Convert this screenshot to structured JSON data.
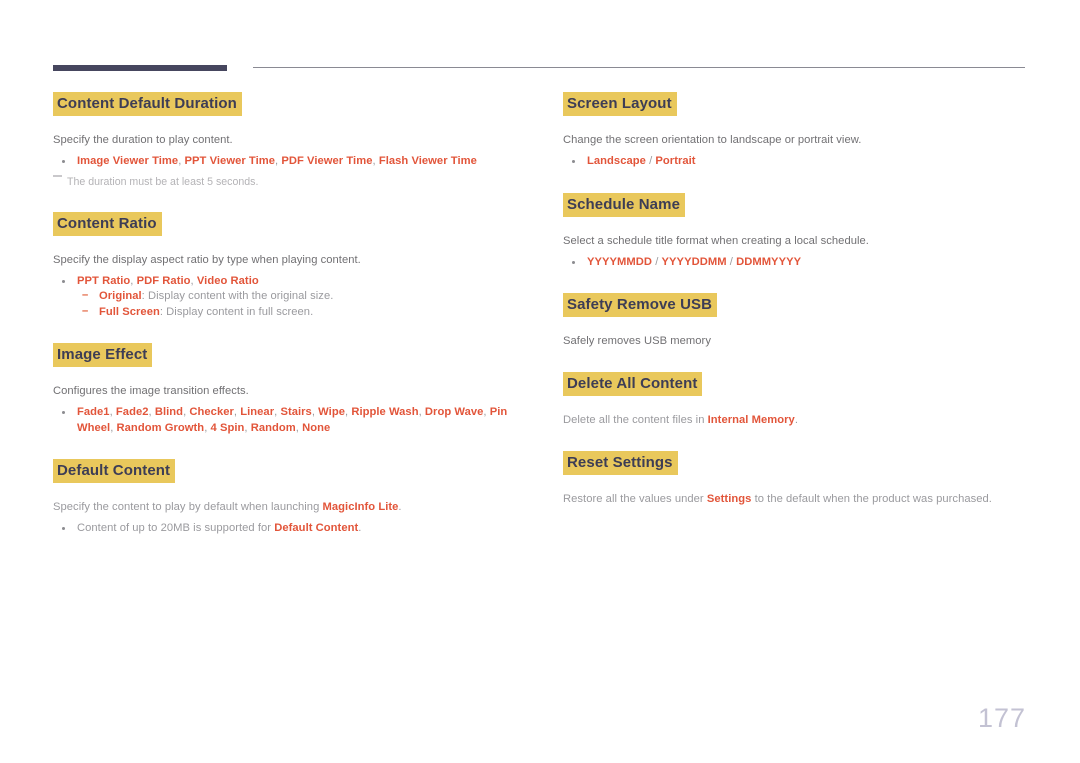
{
  "page": {
    "number": "177",
    "accent_highlight": "#e9c85c",
    "accent_keyword": "#e2553a",
    "heading_color": "#3d3d55",
    "body_color": "#717073",
    "rule_dark": "#46465e",
    "rule_thin": "#8a8a93"
  },
  "left_column": {
    "sections": [
      {
        "heading": "Content Default Duration",
        "desc": "Specify the duration to play content.",
        "bullets": [
          {
            "parts": [
              {
                "t": "Image Viewer Time",
                "k": true
              },
              {
                "t": ", ",
                "k": false
              },
              {
                "t": "PPT Viewer Time",
                "k": true
              },
              {
                "t": ", ",
                "k": false
              },
              {
                "t": "PDF Viewer Time",
                "k": true
              },
              {
                "t": ", ",
                "k": false
              },
              {
                "t": "Flash Viewer Time",
                "k": true
              }
            ]
          }
        ],
        "note": "The duration must be at least 5 seconds."
      },
      {
        "heading": "Content Ratio",
        "desc": "Specify the display aspect ratio by type when playing content.",
        "bullets": [
          {
            "parts": [
              {
                "t": "PPT Ratio",
                "k": true
              },
              {
                "t": ", ",
                "k": false
              },
              {
                "t": "PDF Ratio",
                "k": true
              },
              {
                "t": ", ",
                "k": false
              },
              {
                "t": "Video Ratio",
                "k": true
              }
            ],
            "sub": [
              {
                "parts": [
                  {
                    "t": "Original",
                    "k": true
                  },
                  {
                    "t": ": Display content with the original size.",
                    "k": false
                  }
                ]
              },
              {
                "parts": [
                  {
                    "t": "Full Screen",
                    "k": true
                  },
                  {
                    "t": ": Display content in full screen.",
                    "k": false
                  }
                ]
              }
            ]
          }
        ]
      },
      {
        "heading": "Image Effect",
        "desc": "Configures the image transition effects.",
        "bullets": [
          {
            "parts": [
              {
                "t": "Fade1",
                "k": true
              },
              {
                "t": ", ",
                "k": false
              },
              {
                "t": "Fade2",
                "k": true
              },
              {
                "t": ", ",
                "k": false
              },
              {
                "t": "Blind",
                "k": true
              },
              {
                "t": ", ",
                "k": false
              },
              {
                "t": "Checker",
                "k": true
              },
              {
                "t": ", ",
                "k": false
              },
              {
                "t": "Linear",
                "k": true
              },
              {
                "t": ", ",
                "k": false
              },
              {
                "t": "Stairs",
                "k": true
              },
              {
                "t": ", ",
                "k": false
              },
              {
                "t": "Wipe",
                "k": true
              },
              {
                "t": ", ",
                "k": false
              },
              {
                "t": "Ripple Wash",
                "k": true
              },
              {
                "t": ", ",
                "k": false
              },
              {
                "t": "Drop Wave",
                "k": true
              },
              {
                "t": ", ",
                "k": false
              },
              {
                "t": "Pin Wheel",
                "k": true
              },
              {
                "t": ", ",
                "k": false
              },
              {
                "t": "Random Growth",
                "k": true
              },
              {
                "t": ", ",
                "k": false
              },
              {
                "t": "4 Spin",
                "k": true
              },
              {
                "t": ", ",
                "k": false
              },
              {
                "t": "Random",
                "k": true
              },
              {
                "t": ", ",
                "k": false
              },
              {
                "t": "None",
                "k": true
              }
            ]
          }
        ]
      },
      {
        "heading": "Default Content",
        "desc_parts": [
          {
            "t": "Specify the content to play by default when launching ",
            "k": false
          },
          {
            "t": "MagicInfo Lite",
            "k": true
          },
          {
            "t": ".",
            "k": false
          }
        ],
        "bullets": [
          {
            "parts": [
              {
                "t": "Content of up to 20MB is supported for ",
                "k": false
              },
              {
                "t": "Default Content",
                "k": true
              },
              {
                "t": ".",
                "k": false
              }
            ]
          }
        ]
      }
    ]
  },
  "right_column": {
    "sections": [
      {
        "heading": "Screen Layout",
        "desc": "Change the screen orientation to landscape or portrait view.",
        "bullets": [
          {
            "parts": [
              {
                "t": "Landscape",
                "k": true
              },
              {
                "t": " / ",
                "k": false
              },
              {
                "t": "Portrait",
                "k": true
              }
            ]
          }
        ]
      },
      {
        "heading": "Schedule Name",
        "desc": "Select a schedule title format when creating a local schedule.",
        "bullets": [
          {
            "parts": [
              {
                "t": "YYYYMMDD",
                "k": true
              },
              {
                "t": " / ",
                "k": false
              },
              {
                "t": "YYYYDDMM",
                "k": true
              },
              {
                "t": " / ",
                "k": false
              },
              {
                "t": "DDMMYYYY",
                "k": true
              }
            ]
          }
        ]
      },
      {
        "heading": "Safety Remove USB",
        "desc": "Safely removes USB memory",
        "bullets": []
      },
      {
        "heading": "Delete All Content",
        "desc_parts": [
          {
            "t": "Delete all the content files in ",
            "k": false
          },
          {
            "t": "Internal Memory",
            "k": true
          },
          {
            "t": ".",
            "k": false
          }
        ],
        "bullets": []
      },
      {
        "heading": "Reset Settings",
        "desc_parts": [
          {
            "t": "Restore all the values under ",
            "k": false
          },
          {
            "t": "Settings",
            "k": true
          },
          {
            "t": " to the default when the product was purchased.",
            "k": false
          }
        ],
        "bullets": []
      }
    ]
  }
}
